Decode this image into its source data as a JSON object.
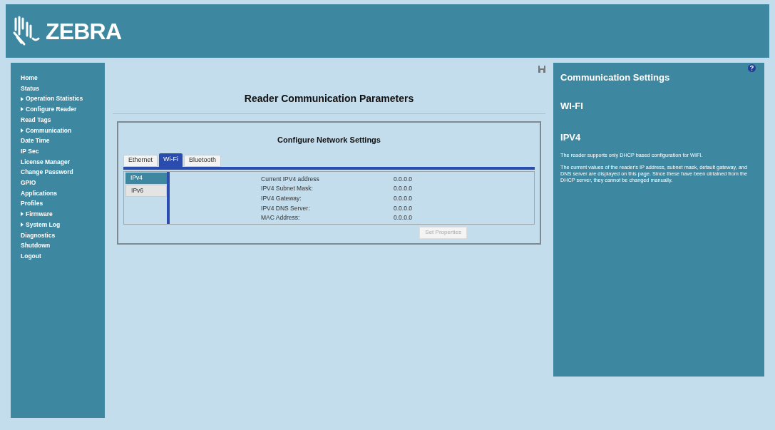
{
  "header": {
    "brand": "ZEBRA"
  },
  "sidebar": {
    "items": [
      {
        "label": "Home",
        "expandable": false
      },
      {
        "label": "Status",
        "expandable": false
      },
      {
        "label": "Operation Statistics",
        "expandable": true
      },
      {
        "label": "Configure Reader",
        "expandable": true
      },
      {
        "label": "Read Tags",
        "expandable": false
      },
      {
        "label": "Communication",
        "expandable": true
      },
      {
        "label": "Date Time",
        "expandable": false
      },
      {
        "label": "IP Sec",
        "expandable": false
      },
      {
        "label": "License Manager",
        "expandable": false
      },
      {
        "label": "Change Password",
        "expandable": false
      },
      {
        "label": "GPIO",
        "expandable": false
      },
      {
        "label": "Applications",
        "expandable": false
      },
      {
        "label": "Profiles",
        "expandable": false
      },
      {
        "label": "Firmware",
        "expandable": true
      },
      {
        "label": "System Log",
        "expandable": true
      },
      {
        "label": "Diagnostics",
        "expandable": false
      },
      {
        "label": "Shutdown",
        "expandable": false
      },
      {
        "label": "Logout",
        "expandable": false
      }
    ]
  },
  "main": {
    "title": "Reader Communication Parameters",
    "section_title": "Configure Network Settings",
    "tabs": [
      {
        "label": "Ethernet",
        "selected": false
      },
      {
        "label": "Wi-Fi",
        "selected": true
      },
      {
        "label": "Bluetooth",
        "selected": false
      }
    ],
    "subtabs": [
      {
        "label": "IPv4",
        "selected": true
      },
      {
        "label": "IPv6",
        "selected": false
      }
    ],
    "fields": [
      {
        "label": "Current IPV4 address",
        "value": "0.0.0.0"
      },
      {
        "label": "IPV4 Subnet Mask:",
        "value": "0.0.0.0"
      },
      {
        "label": "IPV4 Gateway:",
        "value": "0.0.0.0"
      },
      {
        "label": "IPV4 DNS Server:",
        "value": "0.0.0.0"
      },
      {
        "label": "MAC Address:",
        "value": "0.0.0.0"
      }
    ],
    "button": {
      "label": "Set Properties",
      "disabled": true
    }
  },
  "help": {
    "title": "Communication Settings",
    "heading": "WI-FI",
    "subheading": "IPV4",
    "paragraphs": [
      "The reader supports only DHCP based configuration for WIFI.",
      "The current values of the reader's IP address, subnet mask, default gateway, and DNS server are displayed on this page. Since these have been obtained from the DHCP server, they cannot be changed manually."
    ]
  }
}
